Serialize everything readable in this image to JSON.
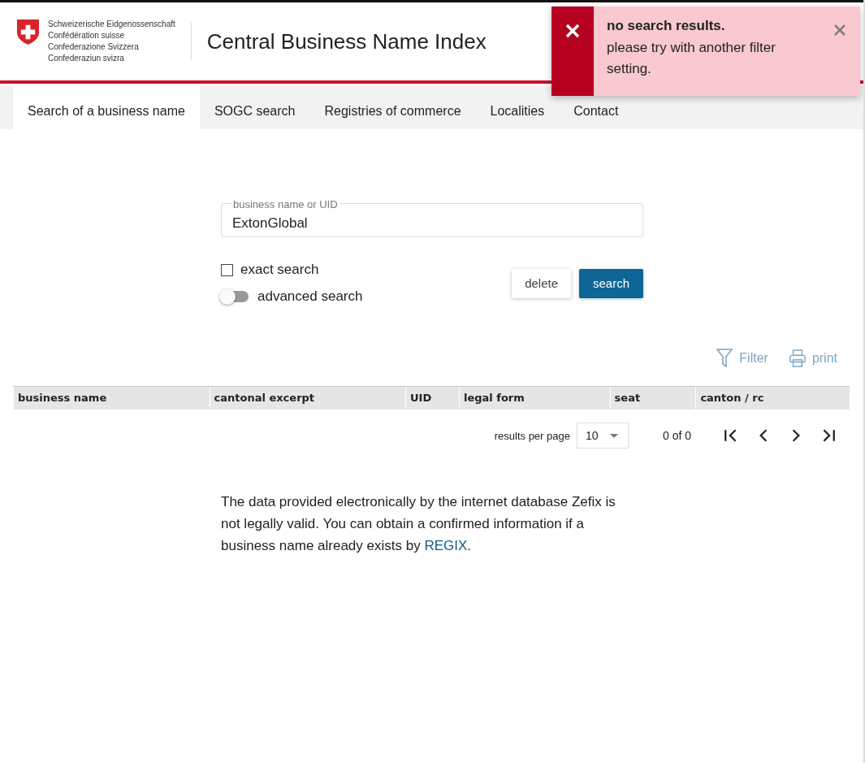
{
  "header": {
    "logo_lines": [
      "Schweizerische Eidgenossenschaft",
      "Confédération suisse",
      "Confederazione Svizzera",
      "Confederaziun svizra"
    ],
    "title": "Central Business Name Index"
  },
  "tabs": [
    {
      "label": "Search of a business name",
      "selected": true
    },
    {
      "label": "SOGC search",
      "selected": false
    },
    {
      "label": "Registries of commerce",
      "selected": false
    },
    {
      "label": "Localities",
      "selected": false
    },
    {
      "label": "Contact",
      "selected": false
    }
  ],
  "toast": {
    "title": "no search results.",
    "message": "please try with another filter setting."
  },
  "search": {
    "placeholder": "business name or UID",
    "value": "ExtonGlobal",
    "exact": {
      "label": "exact search",
      "checked": false
    },
    "advanced": {
      "label": "advanced search",
      "on": false
    },
    "buttons": [
      {
        "label": "delete",
        "kind": "secondary"
      },
      {
        "label": "search",
        "kind": "primary"
      }
    ]
  },
  "actions": [
    {
      "label": "Filter",
      "kind": "filter"
    },
    {
      "label": "print",
      "kind": "print"
    }
  ],
  "table": {
    "columns": [
      "business name",
      "cantonal excerpt",
      "UID",
      "legal form",
      "seat",
      "canton / rc"
    ]
  },
  "pager": {
    "label": "results per page",
    "per_page": "10",
    "range": "0 of 0"
  },
  "disclaimer": {
    "text": "The data provided electronically by the internet database Zefix is not legally valid. You can obtain a confirmed information if a business name already exists by",
    "link": "REGIX",
    "end": "."
  }
}
